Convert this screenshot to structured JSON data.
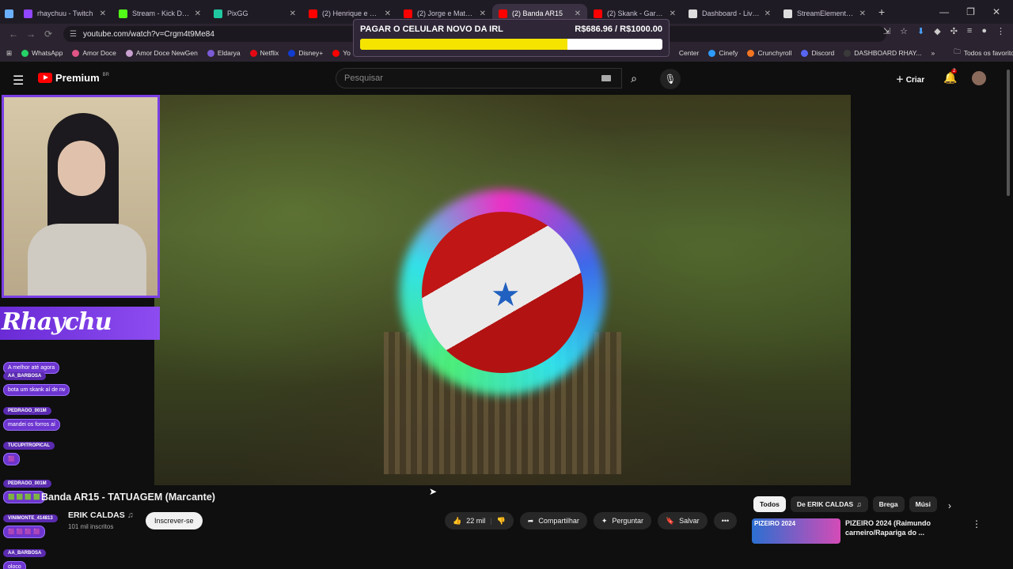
{
  "browser": {
    "tabs": [
      {
        "label": "rhaychuu - Twitch",
        "color": "#9146ff"
      },
      {
        "label": "Stream - Kick Dashb",
        "color": "#53fc18"
      },
      {
        "label": "PixGG",
        "color": "#1fc8a0"
      },
      {
        "label": "(2) Henrique e Julian",
        "color": "#ff0000"
      },
      {
        "label": "(2) Jorge e Mateus",
        "color": "#ff0000"
      },
      {
        "label": "(2) Banda AR15",
        "color": "#ff0000"
      },
      {
        "label": "(2) Skank - Garota N",
        "color": "#ff0000"
      },
      {
        "label": "Dashboard - LivePix",
        "color": "#dddddd"
      },
      {
        "label": "StreamElements - A",
        "color": "#dddddd"
      }
    ],
    "active_tab_index": 5,
    "new_tab_icon": "plus-icon",
    "url": "youtube.com/watch?v=Crgm4t9Me84",
    "bookmarks": [
      {
        "label": "WhatsApp",
        "color": "#25d366"
      },
      {
        "label": "Amor Doce",
        "color": "#e05585"
      },
      {
        "label": "Amor Doce NewGen",
        "color": "#c9a0d0"
      },
      {
        "label": "Eldarya",
        "color": "#7b5bd6"
      },
      {
        "label": "Netflix",
        "color": "#e50914"
      },
      {
        "label": "Disney+",
        "color": "#113ccf"
      },
      {
        "label": "Yo",
        "color": "#ff0000"
      },
      {
        "label": "Center",
        "color": "#2b2430"
      },
      {
        "label": "Cinefy",
        "color": "#2e9bff"
      },
      {
        "label": "Crunchyroll",
        "color": "#f47521"
      },
      {
        "label": "Discord",
        "color": "#5865f2"
      },
      {
        "label": "DASHBOARD RHAY...",
        "color": "#3a3a3a"
      }
    ],
    "favorites_label": "Todos os favoritos"
  },
  "donation_goal": {
    "title": "PAGAR O CELULAR NOVO DA IRL",
    "amount": "R$686.96 / R$1000.00",
    "progress": 0.687
  },
  "youtube": {
    "brand": "Premium",
    "country": "BR",
    "search_placeholder": "Pesquisar",
    "create_label": "Criar",
    "notifications": "2"
  },
  "stream_overlay": {
    "streamer_name": "Rhaychu",
    "chat": [
      {
        "user": "",
        "text": "A melhor até agora"
      },
      {
        "user": "AA_BARBOSA",
        "text": "bota um skank aí de nv"
      },
      {
        "user": "PEDRAOO_001M",
        "text": "mandei os forros aí"
      },
      {
        "user": "TUCUPITROPICAL",
        "text": "🟪"
      },
      {
        "user": "PEDRAOO_001M",
        "text": "🟩 🟩 🟩 🟩"
      },
      {
        "user": "VINIMONTE_414813",
        "text": "🟪 🟪 🟪 🟪"
      },
      {
        "user": "AA_BARBOSA",
        "text": "oloco"
      }
    ]
  },
  "video": {
    "title": "Banda AR15 - TATUAGEM (Marcante)",
    "channel": "ERIK CALDAS",
    "subscribers": "101 mil inscritos",
    "subscribe_label": "Inscrever-se",
    "likes": "22 mil",
    "share_label": "Compartilhar",
    "ask_label": "Perguntar",
    "save_label": "Salvar"
  },
  "related": {
    "chips": [
      "Todos",
      "De ERIK CALDAS",
      "Brega",
      "Músi"
    ],
    "items": [
      {
        "thumb_text": "PIZEIRO 2024",
        "title": "PIZEIRO 2024 (Raimundo carneiro/Rapariga do ..."
      }
    ]
  }
}
